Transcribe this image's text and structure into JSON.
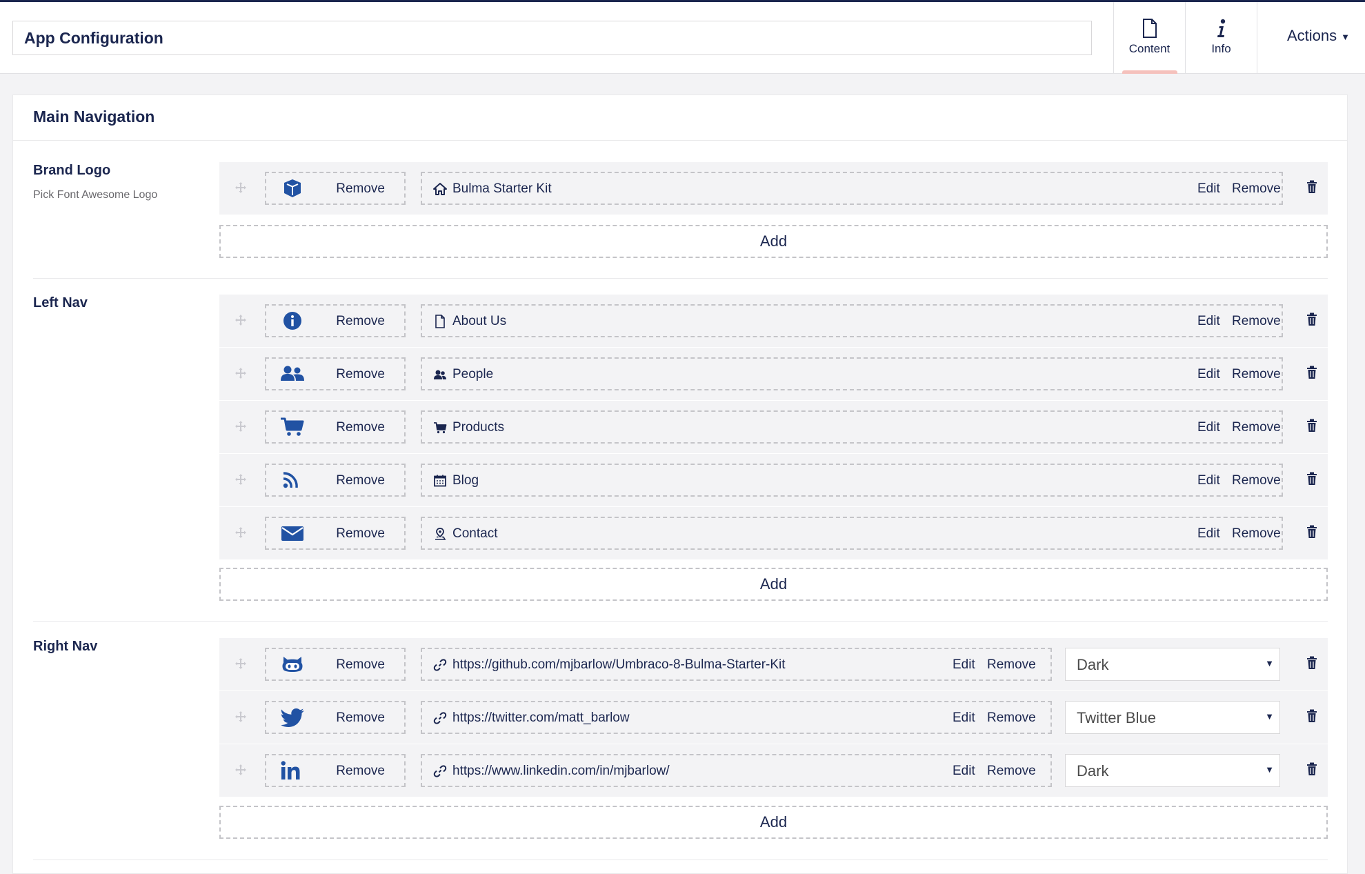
{
  "header": {
    "name_value": "App Configuration",
    "tabs": [
      {
        "label": "Content",
        "icon": "document-icon",
        "active": true
      },
      {
        "label": "Info",
        "icon": "info-icon",
        "active": false
      }
    ],
    "actions_label": "Actions"
  },
  "panel": {
    "title": "Main Navigation",
    "brand": {
      "label": "Brand Logo",
      "description": "Pick Font Awesome Logo",
      "items": [
        {
          "icon": "cube-icon",
          "remove_label": "Remove",
          "link_icon": "home-icon",
          "link_text": "Bulma Starter Kit",
          "edit_label": "Edit",
          "link_remove_label": "Remove"
        }
      ],
      "add_label": "Add"
    },
    "left_nav": {
      "label": "Left Nav",
      "items": [
        {
          "icon": "info-circle-icon",
          "remove_label": "Remove",
          "link_icon": "document-icon",
          "link_text": "About Us",
          "edit_label": "Edit",
          "link_remove_label": "Remove"
        },
        {
          "icon": "users-icon",
          "remove_label": "Remove",
          "link_icon": "people-icon",
          "link_text": "People",
          "edit_label": "Edit",
          "link_remove_label": "Remove"
        },
        {
          "icon": "shopping-cart-icon",
          "remove_label": "Remove",
          "link_icon": "cart-icon",
          "link_text": "Products",
          "edit_label": "Edit",
          "link_remove_label": "Remove"
        },
        {
          "icon": "rss-icon",
          "remove_label": "Remove",
          "link_icon": "calendar-icon",
          "link_text": "Blog",
          "edit_label": "Edit",
          "link_remove_label": "Remove"
        },
        {
          "icon": "envelope-icon",
          "remove_label": "Remove",
          "link_icon": "map-pin-icon",
          "link_text": "Contact",
          "edit_label": "Edit",
          "link_remove_label": "Remove"
        }
      ],
      "add_label": "Add"
    },
    "right_nav": {
      "label": "Right Nav",
      "items": [
        {
          "icon": "github-icon",
          "remove_label": "Remove",
          "link_icon": "link-icon",
          "link_text": "https://github.com/mjbarlow/Umbraco-8-Bulma-Starter-Kit",
          "edit_label": "Edit",
          "link_remove_label": "Remove",
          "style": "Dark"
        },
        {
          "icon": "twitter-icon",
          "remove_label": "Remove",
          "link_icon": "link-icon",
          "link_text": "https://twitter.com/matt_barlow",
          "edit_label": "Edit",
          "link_remove_label": "Remove",
          "style": "Twitter Blue"
        },
        {
          "icon": "linkedin-icon",
          "remove_label": "Remove",
          "link_icon": "link-icon",
          "link_text": "https://www.linkedin.com/in/mjbarlow/",
          "edit_label": "Edit",
          "link_remove_label": "Remove",
          "style": "Dark"
        }
      ],
      "add_label": "Add"
    }
  },
  "colors": {
    "brand_navy": "#1b264f",
    "icon_blue": "#2152a3",
    "active_tab_indicator": "#f5c1bc",
    "dashed_border": "#c4c4c8"
  }
}
